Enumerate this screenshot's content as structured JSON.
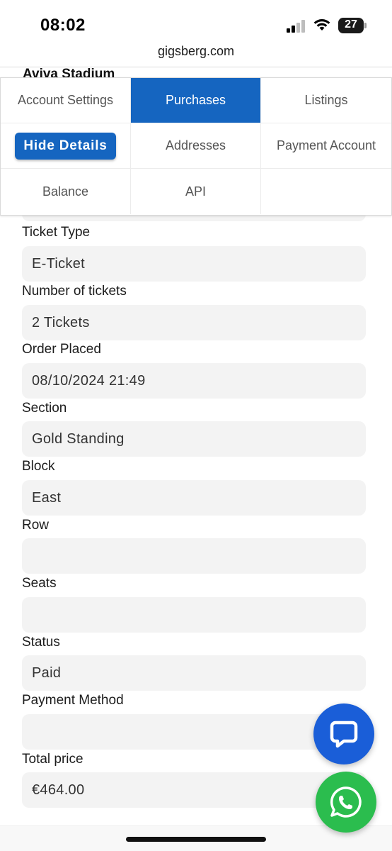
{
  "status_bar": {
    "time": "08:02",
    "battery": "27"
  },
  "browser": {
    "url": "gigsberg.com"
  },
  "header": {
    "title": "Aviva Stadium"
  },
  "tabs": {
    "account_settings": "Account Settings",
    "purchases": "Purchases",
    "listings": "Listings",
    "hide_details": "Hide Details",
    "addresses": "Addresses",
    "payment_account": "Payment Account",
    "balance": "Balance",
    "api": "API"
  },
  "fields": [
    {
      "label": "Ticket Type",
      "value": "E-Ticket"
    },
    {
      "label": "Number of tickets",
      "value": "2 Tickets"
    },
    {
      "label": "Order Placed",
      "value": "08/10/2024 21:49"
    },
    {
      "label": "Section",
      "value": "Gold Standing"
    },
    {
      "label": "Block",
      "value": "East"
    },
    {
      "label": "Row",
      "value": ""
    },
    {
      "label": "Seats",
      "value": ""
    },
    {
      "label": "Status",
      "value": "Paid"
    },
    {
      "label": "Payment Method",
      "value": ""
    },
    {
      "label": "Total price",
      "value": "€464.00"
    }
  ],
  "colors": {
    "accent": "#1565c0",
    "chat_fab": "#1a5ed8",
    "whatsapp": "#2bbd4e",
    "field_bg": "#f3f3f3"
  },
  "icons": {
    "chat": "chat-bubble-icon",
    "whatsapp": "whatsapp-icon"
  }
}
